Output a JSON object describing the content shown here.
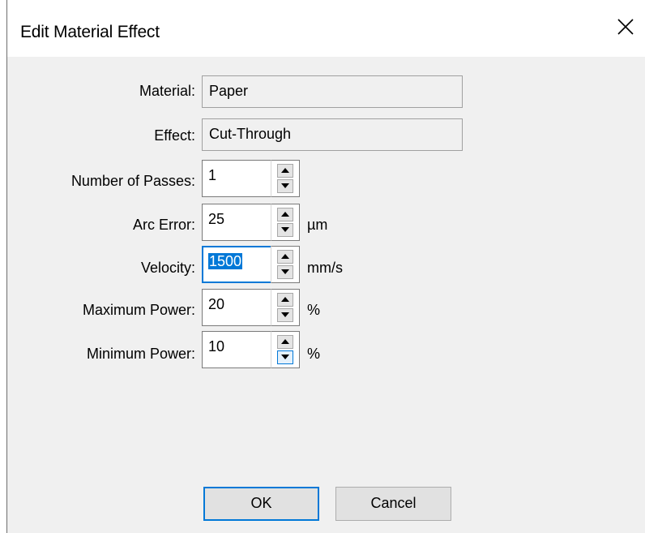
{
  "window": {
    "title": "Edit Material Effect"
  },
  "fields": {
    "material": {
      "label": "Material:",
      "value": "Paper"
    },
    "effect": {
      "label": "Effect:",
      "value": "Cut-Through"
    },
    "passes": {
      "label": "Number of Passes:",
      "value": "1",
      "unit": ""
    },
    "arc_error": {
      "label": "Arc Error:",
      "value": "25",
      "unit": "µm"
    },
    "velocity": {
      "label": "Velocity:",
      "value": "1500",
      "unit": "mm/s"
    },
    "max_power": {
      "label": "Maximum Power:",
      "value": "20",
      "unit": "%"
    },
    "min_power": {
      "label": "Minimum Power:",
      "value": "10",
      "unit": "%"
    }
  },
  "buttons": {
    "ok": "OK",
    "cancel": "Cancel"
  },
  "colors": {
    "accent": "#0078d7",
    "dialog_bg": "#f0f0f0"
  },
  "icons": {
    "close": "close-icon",
    "up": "arrow-up-icon",
    "down": "arrow-down-icon"
  }
}
